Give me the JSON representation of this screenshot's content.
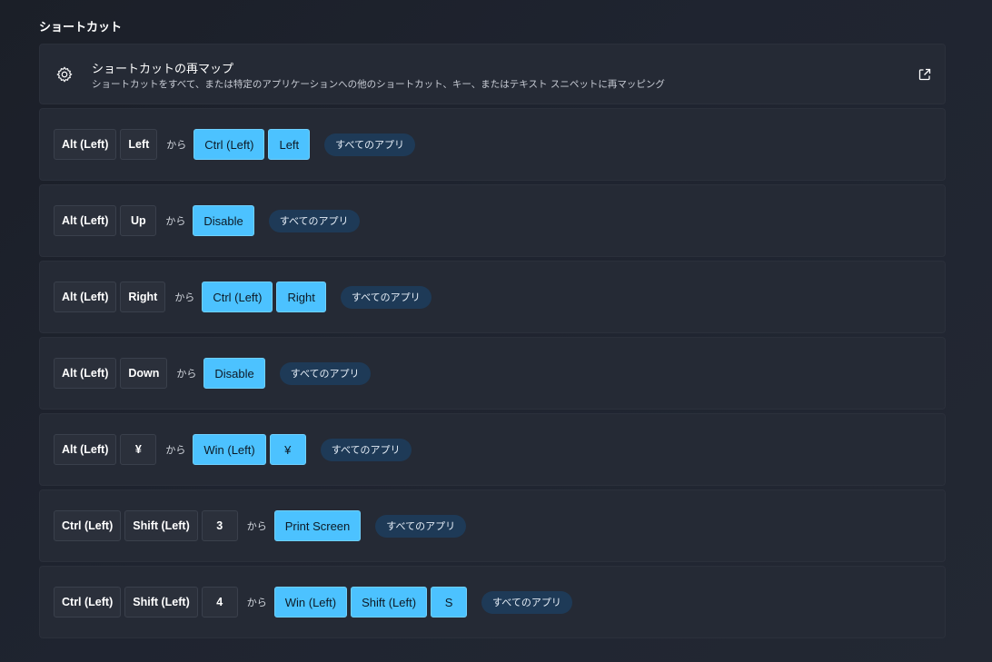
{
  "section": {
    "title": "ショートカット"
  },
  "header": {
    "title": "ショートカットの再マップ",
    "description": "ショートカットをすべて、または特定のアプリケーションへの他のショートカット、キー、またはテキスト スニペットに再マッピング",
    "icon": "gear-icon",
    "link_icon": "open-external-icon"
  },
  "colors": {
    "accent": "#4cc2ff",
    "card": "#252a35",
    "badge": "#1e3a57"
  },
  "mappings": [
    {
      "from": [
        "Alt (Left)",
        "Left"
      ],
      "connector": "から",
      "to": [
        "Ctrl (Left)",
        "Left"
      ],
      "scope": "すべてのアプリ"
    },
    {
      "from": [
        "Alt (Left)",
        "Up"
      ],
      "connector": "から",
      "to": [
        "Disable"
      ],
      "scope": "すべてのアプリ"
    },
    {
      "from": [
        "Alt (Left)",
        "Right"
      ],
      "connector": "から",
      "to": [
        "Ctrl (Left)",
        "Right"
      ],
      "scope": "すべてのアプリ"
    },
    {
      "from": [
        "Alt (Left)",
        "Down"
      ],
      "connector": "から",
      "to": [
        "Disable"
      ],
      "scope": "すべてのアプリ"
    },
    {
      "from": [
        "Alt (Left)",
        "¥"
      ],
      "connector": "から",
      "to": [
        "Win (Left)",
        "¥"
      ],
      "scope": "すべてのアプリ"
    },
    {
      "from": [
        "Ctrl (Left)",
        "Shift (Left)",
        "3"
      ],
      "connector": "から",
      "to": [
        "Print Screen"
      ],
      "scope": "すべてのアプリ"
    },
    {
      "from": [
        "Ctrl (Left)",
        "Shift (Left)",
        "4"
      ],
      "connector": "から",
      "to": [
        "Win (Left)",
        "Shift (Left)",
        "S"
      ],
      "scope": "すべてのアプリ"
    }
  ]
}
